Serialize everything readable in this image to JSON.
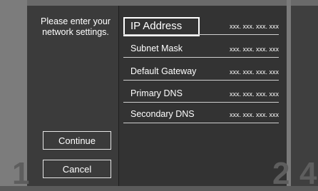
{
  "steps": {
    "left": "1",
    "middle": "2",
    "right": "4"
  },
  "prompt": "Please enter your network settings.",
  "buttons": {
    "continue": "Continue",
    "cancel": "Cancel"
  },
  "fields": [
    {
      "label": "IP Address",
      "value": "xxx. xxx. xxx. xxx",
      "selected": true
    },
    {
      "label": "Subnet Mask",
      "value": "xxx. xxx. xxx. xxx",
      "selected": false
    },
    {
      "label": "Default Gateway",
      "value": "xxx. xxx. xxx. xxx",
      "selected": false
    },
    {
      "label": "Primary DNS",
      "value": "xxx. xxx. xxx. xxx",
      "selected": false
    },
    {
      "label": "Secondary DNS",
      "value": "xxx. xxx. xxx. xxx",
      "selected": false
    }
  ]
}
